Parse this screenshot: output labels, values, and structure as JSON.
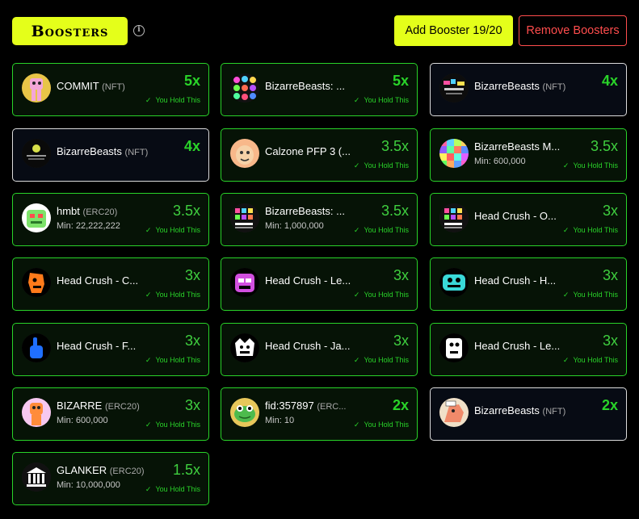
{
  "header": {
    "title": "Boosters",
    "info_icon": "i",
    "add_button": "Add Booster 19/20",
    "remove_button": "Remove Boosters"
  },
  "colors": {
    "accent": "#e4ff1a",
    "held_green": "#29d329",
    "danger": "#ff4d4d"
  },
  "cards": [
    {
      "name": "COMMIT",
      "tag": "(NFT)",
      "min": "",
      "multiplier": "5x",
      "held": "You Hold This",
      "icon": "pink-character-avatar"
    },
    {
      "name": "BizarreBeasts: ...",
      "tag": "",
      "min": "",
      "multiplier": "5x",
      "held": "You Hold This",
      "icon": "colorful-beasts-grid-avatar"
    },
    {
      "name": "BizarreBeasts",
      "tag": "(NFT)",
      "min": "",
      "multiplier": "4x",
      "held": "",
      "icon": "dark-collage-avatar"
    },
    {
      "name": "BizarreBeasts",
      "tag": "(NFT)",
      "min": "",
      "multiplier": "4x",
      "held": "",
      "icon": "dark-orb-avatar"
    },
    {
      "name": "Calzone PFP 3 (...",
      "tag": "",
      "min": "",
      "multiplier": "3.5x",
      "held": "You Hold This",
      "icon": "calzone-avatar"
    },
    {
      "name": "BizarreBeasts M...",
      "tag": "",
      "min": "Min: 600,000",
      "multiplier": "3.5x",
      "held": "You Hold This",
      "icon": "mosaic-avatar"
    },
    {
      "name": "hmbt",
      "tag": "(ERC20)",
      "min": "Min: 22,222,222",
      "multiplier": "3.5x",
      "held": "You Hold This",
      "icon": "green-monster-avatar"
    },
    {
      "name": "BizarreBeasts: ...",
      "tag": "",
      "min": "Min: 1,000,000",
      "multiplier": "3.5x",
      "held": "You Hold This",
      "icon": "head-crush-logo-avatar"
    },
    {
      "name": "Head Crush - O...",
      "tag": "",
      "min": "",
      "multiplier": "3x",
      "held": "You Hold This",
      "icon": "head-crush-logo-avatar"
    },
    {
      "name": "Head Crush - C...",
      "tag": "",
      "min": "",
      "multiplier": "3x",
      "held": "You Hold This",
      "icon": "orange-head-avatar"
    },
    {
      "name": "Head Crush - Le...",
      "tag": "",
      "min": "",
      "multiplier": "3x",
      "held": "You Hold This",
      "icon": "purple-head-avatar"
    },
    {
      "name": "Head Crush - H...",
      "tag": "",
      "min": "",
      "multiplier": "3x",
      "held": "You Hold This",
      "icon": "cyan-head-avatar"
    },
    {
      "name": "Head Crush - F...",
      "tag": "",
      "min": "",
      "multiplier": "3x",
      "held": "You Hold This",
      "icon": "blue-hand-avatar"
    },
    {
      "name": "Head Crush - Ja...",
      "tag": "",
      "min": "",
      "multiplier": "3x",
      "held": "You Hold This",
      "icon": "white-creature-avatar"
    },
    {
      "name": "Head Crush - Le...",
      "tag": "",
      "min": "",
      "multiplier": "3x",
      "held": "You Hold This",
      "icon": "white-head-avatar"
    },
    {
      "name": "BIZARRE",
      "tag": "(ERC20)",
      "min": "Min: 600,000",
      "multiplier": "3x",
      "held": "You Hold This",
      "icon": "orange-beast-avatar"
    },
    {
      "name": "fid:357897",
      "tag": "(ERC...",
      "min": "Min: 10",
      "multiplier": "2x",
      "held": "You Hold This",
      "icon": "green-frog-avatar"
    },
    {
      "name": "BizarreBeasts",
      "tag": "(NFT)",
      "min": "",
      "multiplier": "2x",
      "held": "",
      "icon": "sketch-beast-avatar"
    },
    {
      "name": "GLANKER",
      "tag": "(ERC20)",
      "min": "Min: 10,000,000",
      "multiplier": "1.5x",
      "held": "You Hold This",
      "icon": "bank-building-avatar"
    }
  ]
}
